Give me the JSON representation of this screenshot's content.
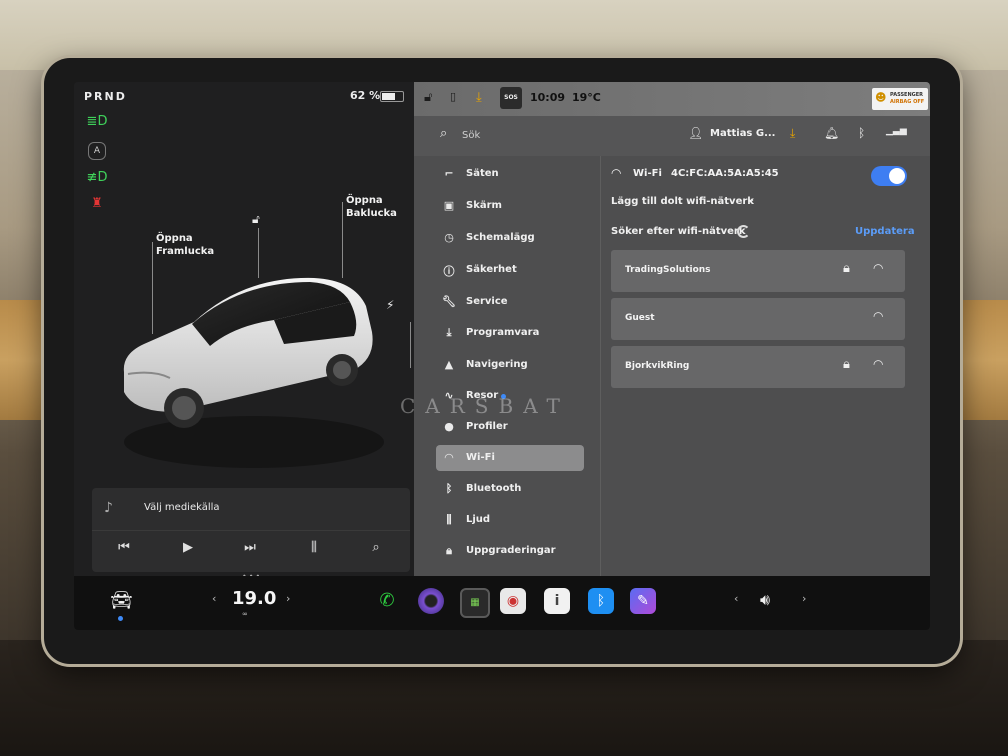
{
  "status": {
    "gear": "PRND",
    "battery_pct": "62 %",
    "time": "10:09",
    "temperature": "19°C",
    "sos": "SOS",
    "airbag_line1": "PASSENGER",
    "airbag_line2": "AIRBAG OFF"
  },
  "car": {
    "frunk_label": "Öppna\nFramlucka",
    "trunk_label": "Öppna\nBaklucka"
  },
  "media": {
    "source_label": "Välj mediekälla"
  },
  "header": {
    "search_placeholder": "Sök",
    "user_name": "Mattias G..."
  },
  "nav": {
    "items": [
      {
        "label": "Säten",
        "icon": "seat-icon"
      },
      {
        "label": "Skärm",
        "icon": "display-icon"
      },
      {
        "label": "Schemalägg",
        "icon": "clock-icon"
      },
      {
        "label": "Säkerhet",
        "icon": "safety-icon"
      },
      {
        "label": "Service",
        "icon": "wrench-icon"
      },
      {
        "label": "Programvara",
        "icon": "download-icon"
      },
      {
        "label": "Navigering",
        "icon": "navigation-icon"
      },
      {
        "label": "Resor",
        "icon": "trips-icon"
      },
      {
        "label": "Profiler",
        "icon": "profile-icon"
      },
      {
        "label": "Wi-Fi",
        "icon": "wifi-icon"
      },
      {
        "label": "Bluetooth",
        "icon": "bluetooth-icon"
      },
      {
        "label": "Ljud",
        "icon": "sliders-icon"
      },
      {
        "label": "Uppgraderingar",
        "icon": "lock-icon"
      }
    ],
    "active": "Wi-Fi"
  },
  "wifi": {
    "title": "Wi-Fi",
    "mac": "4C:FC:AA:5A:A5:45",
    "enabled": true,
    "add_hidden": "Lägg till dolt wifi-nätverk",
    "searching": "Söker efter wifi-nätverk",
    "update_label": "Uppdatera",
    "networks": [
      {
        "name": "TradingSolutions",
        "secured": true
      },
      {
        "name": "Guest",
        "secured": false
      },
      {
        "name": "BjorkvikRing",
        "secured": true
      }
    ]
  },
  "dock": {
    "cabin_temp": "19.0"
  },
  "watermark": "CARSBAT"
}
